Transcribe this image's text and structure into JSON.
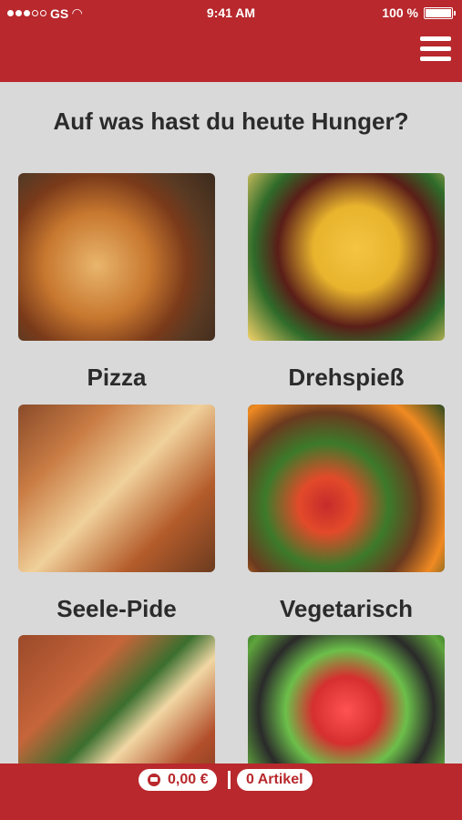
{
  "status_bar": {
    "carrier": "GS",
    "time": "9:41 AM",
    "battery": "100 %"
  },
  "heading": "Auf was hast du heute Hunger?",
  "categories": [
    {
      "label": "Pizza",
      "image": "pizza-image"
    },
    {
      "label": "Drehspieß",
      "image": "doner-image"
    },
    {
      "label": "Seele-Pide",
      "image": "pide-image"
    },
    {
      "label": "Vegetarisch",
      "image": "vegetables-image"
    },
    {
      "label": "",
      "image": "lahmacun-image"
    },
    {
      "label": "",
      "image": "salad-image"
    }
  ],
  "cart": {
    "total": "0,00 €",
    "items": "0 Artikel"
  },
  "colors": {
    "brand_red": "#b8282c",
    "background": "#d9d9d9"
  }
}
